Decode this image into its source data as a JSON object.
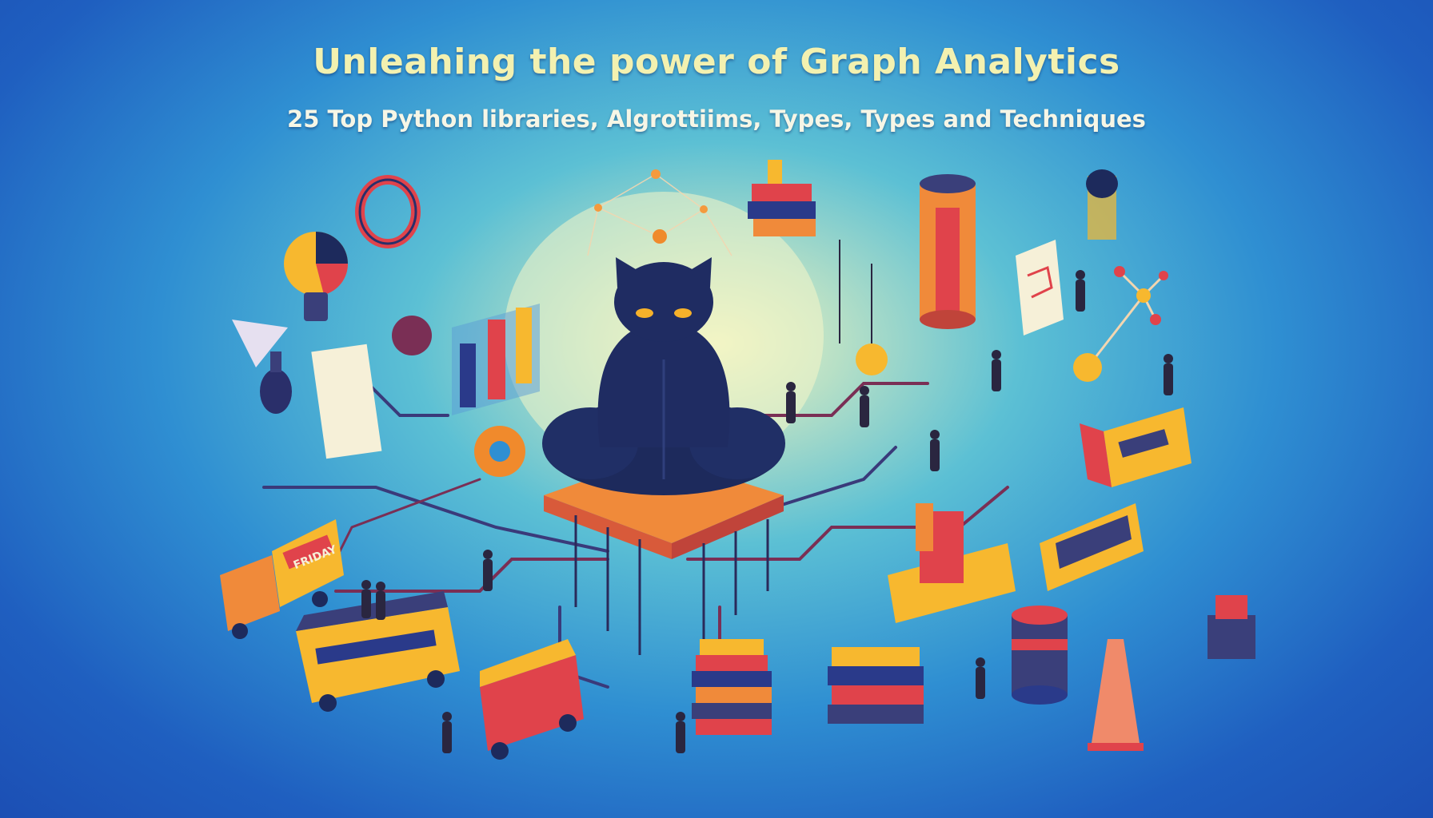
{
  "hero": {
    "title": "Unleahing the power of Graph Analytics",
    "subtitle": "25 Top Python libraries, Algrottiims, Types, Types and Techniques"
  },
  "palette": {
    "background": "#1f5fc0",
    "glow": "#eef3c0",
    "cat": "#1d2a5c",
    "platform": "#f08a3a",
    "accent_red": "#e0434b",
    "accent_yellow": "#f7b82f"
  },
  "illustration": {
    "truck_sign": "FRIDAY"
  }
}
